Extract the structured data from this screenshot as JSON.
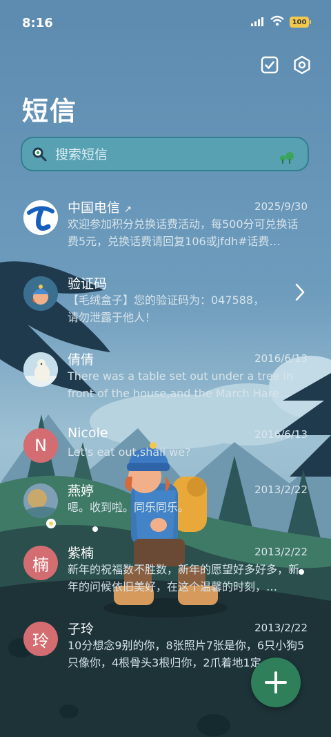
{
  "status_bar": {
    "time": "8:16",
    "battery": "100"
  },
  "header": {
    "title": "短信"
  },
  "search": {
    "placeholder": "搜索短信"
  },
  "messages": [
    {
      "name": "中国电信",
      "date": "2025/9/30",
      "preview": "欢迎参加积分兑换话费活动，每500分可兑换话费5元，兑换话费请回复106或jfdh#话费…"
    },
    {
      "name": "验证码",
      "date": "",
      "preview": "【毛绒盒子】您的验证码为：047588，请勿泄露于他人！"
    },
    {
      "name": "倩倩",
      "date": "2016/6/13",
      "preview": "There was a table set out under a tree in front of the house,and the March Hare an…"
    },
    {
      "name": "Nicole",
      "avatar_letter": "N",
      "date": "2016/6/13",
      "preview": "Let's eat out,shall we?"
    },
    {
      "name": "燕婷",
      "date": "2013/2/22",
      "preview": "嗯。收到啦。同乐同乐。"
    },
    {
      "name": "紫楠",
      "avatar_letter": "楠",
      "date": "2013/2/22",
      "preview": "新年的祝福数不胜数，新年的愿望好多好多，新年的问候依旧美好，在这个温馨的时刻，…"
    },
    {
      "name": "子玲",
      "avatar_letter": "玲",
      "date": "2013/2/22",
      "preview": "10分想念9别的你，8张照片7张是你，6只小狗5只像你，4根骨头3根归你，2爪着地1定…"
    }
  ],
  "colors": {
    "accent_green": "#2e7f5a",
    "avatar_letter_bg": "#d46d72",
    "search_bg": "#58a1b3"
  },
  "icons": [
    "signal-icon",
    "wifi-icon",
    "battery-icon",
    "checkbox-icon",
    "settings-icon",
    "search-icon",
    "chevron-right-icon",
    "plus-icon"
  ]
}
